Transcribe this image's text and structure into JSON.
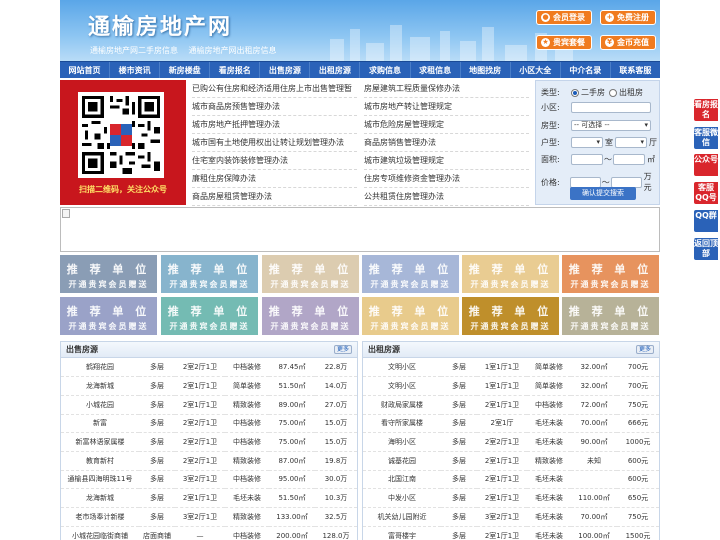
{
  "header": {
    "site_title": "通榆房地产网",
    "sub_links": [
      "通榆房地产网二手房信息",
      "通榆房地产网出租房信息"
    ],
    "buttons": [
      {
        "label": "会员登录",
        "icon": "user-icon"
      },
      {
        "label": "免费注册",
        "icon": "user-add-icon"
      },
      {
        "label": "贵宾套餐",
        "icon": "vip-icon"
      },
      {
        "label": "金币充值",
        "icon": "coin-icon"
      }
    ]
  },
  "nav": [
    "网站首页",
    "楼市资讯",
    "新房楼盘",
    "看房报名",
    "出售房源",
    "出租房源",
    "求购信息",
    "求租信息",
    "地图找房",
    "小区大全",
    "中介名录",
    "联系客服"
  ],
  "qr": {
    "caption": "扫描二维码，关注公众号"
  },
  "news": {
    "left": [
      "已购公有住房和经济适用住房上市出售管理暂",
      "城市商品房预售管理办法",
      "城市房地产抵押管理办法",
      "城市国有土地使用权出让转让规划管理办法",
      "住宅室内装饰装修管理办法",
      "廉租住房保障办法",
      "商品房屋租赁管理办法"
    ],
    "right": [
      "房屋建筑工程质量保修办法",
      "城市房地产转让管理规定",
      "城市危险房屋管理规定",
      "商品房销售管理办法",
      "城市建筑垃圾管理规定",
      "住房专项维修资金管理办法",
      "公共租赁住房管理办法"
    ]
  },
  "search": {
    "type_label": "类型:",
    "type_options": [
      "二手房",
      "出租房"
    ],
    "community_label": "小区:",
    "house_type_label": "房型:",
    "house_type_value": "-- 可选择 --",
    "layout_label": "户型:",
    "room_unit": "室",
    "hall_unit": "厅",
    "area_label": "面积:",
    "range_sep": "～",
    "area_unit": "㎡",
    "price_label": "价格:",
    "price_unit": "万元",
    "submit_label": "确认提交搜索"
  },
  "ads": {
    "title": "推 荐 单 位",
    "subtitle": "开通贵宾会员赠送",
    "colors": [
      "#8a9db5",
      "#87b4cd",
      "#dcccb0",
      "#a7b7d8",
      "#e9cc92",
      "#e7935e",
      "#9aa2c8",
      "#74bbb3",
      "#b1a6c7",
      "#e8cb8c",
      "#bf8f2b",
      "#b7b298"
    ]
  },
  "sale": {
    "title": "出售房源",
    "more_label": "更多",
    "rows": [
      [
        "鹤翔花园",
        "多层",
        "2室2厅1卫",
        "中档装修",
        "87.45㎡",
        "22.8万"
      ],
      [
        "龙海新城",
        "多层",
        "2室1厅1卫",
        "简单装修",
        "51.50㎡",
        "14.0万"
      ],
      [
        "小城花园",
        "多层",
        "2室1厅1卫",
        "精致装修",
        "89.00㎡",
        "27.0万"
      ],
      [
        "新富",
        "多层",
        "2室2厅1卫",
        "中档装修",
        "75.00㎡",
        "15.0万"
      ],
      [
        "新富林语家属楼",
        "多层",
        "2室2厅1卫",
        "中档装修",
        "75.00㎡",
        "15.0万"
      ],
      [
        "教育新村",
        "多层",
        "2室2厅1卫",
        "精致装修",
        "87.00㎡",
        "19.8万"
      ],
      [
        "通榆县四海明珠11号",
        "多层",
        "3室2厅1卫",
        "中档装修",
        "95.00㎡",
        "30.0万"
      ],
      [
        "龙海新城",
        "多层",
        "2室1厅1卫",
        "毛坯未装",
        "51.50㎡",
        "10.3万"
      ],
      [
        "老市场奉计新楼",
        "多层",
        "3室2厅1卫",
        "精致装修",
        "133.00㎡",
        "32.5万"
      ],
      [
        "小城花园临街商铺",
        "店面商铺",
        "—",
        "中档装修",
        "200.00㎡",
        "128.0万"
      ]
    ]
  },
  "rent": {
    "title": "出租房源",
    "more_label": "更多",
    "rows": [
      [
        "文明小区",
        "多层",
        "1室1厅1卫",
        "简单装修",
        "32.00㎡",
        "700元"
      ],
      [
        "文明小区",
        "多层",
        "1室1厅1卫",
        "简单装修",
        "32.00㎡",
        "700元"
      ],
      [
        "财政局家属楼",
        "多层",
        "2室1厅1卫",
        "中档装修",
        "72.00㎡",
        "750元"
      ],
      [
        "看守所家属楼",
        "多层",
        "2室1厅",
        "毛坯未装",
        "70.00㎡",
        "666元"
      ],
      [
        "海明小区",
        "多层",
        "2室2厅1卫",
        "毛坯未装",
        "90.00㎡",
        "1000元"
      ],
      [
        "诚基花园",
        "多层",
        "2室1厅1卫",
        "精致装修",
        "未知",
        "600元"
      ],
      [
        "北国江南",
        "多层",
        "2室1厅1卫",
        "毛坯未装",
        "",
        "600元"
      ],
      [
        "中发小区",
        "多层",
        "2室1厅1卫",
        "毛坯未装",
        "110.00㎡",
        "650元"
      ],
      [
        "机关幼儿园附近",
        "多层",
        "3室2厅1卫",
        "毛坯未装",
        "70.00㎡",
        "750元"
      ],
      [
        "富哥楼宇",
        "多层",
        "2室1厅1卫",
        "毛坯未装",
        "100.00㎡",
        "1500元"
      ]
    ]
  },
  "side": [
    "看房报名",
    "客服微信",
    "公众号",
    "客服QQ号",
    "QQ群",
    "返回顶部"
  ]
}
